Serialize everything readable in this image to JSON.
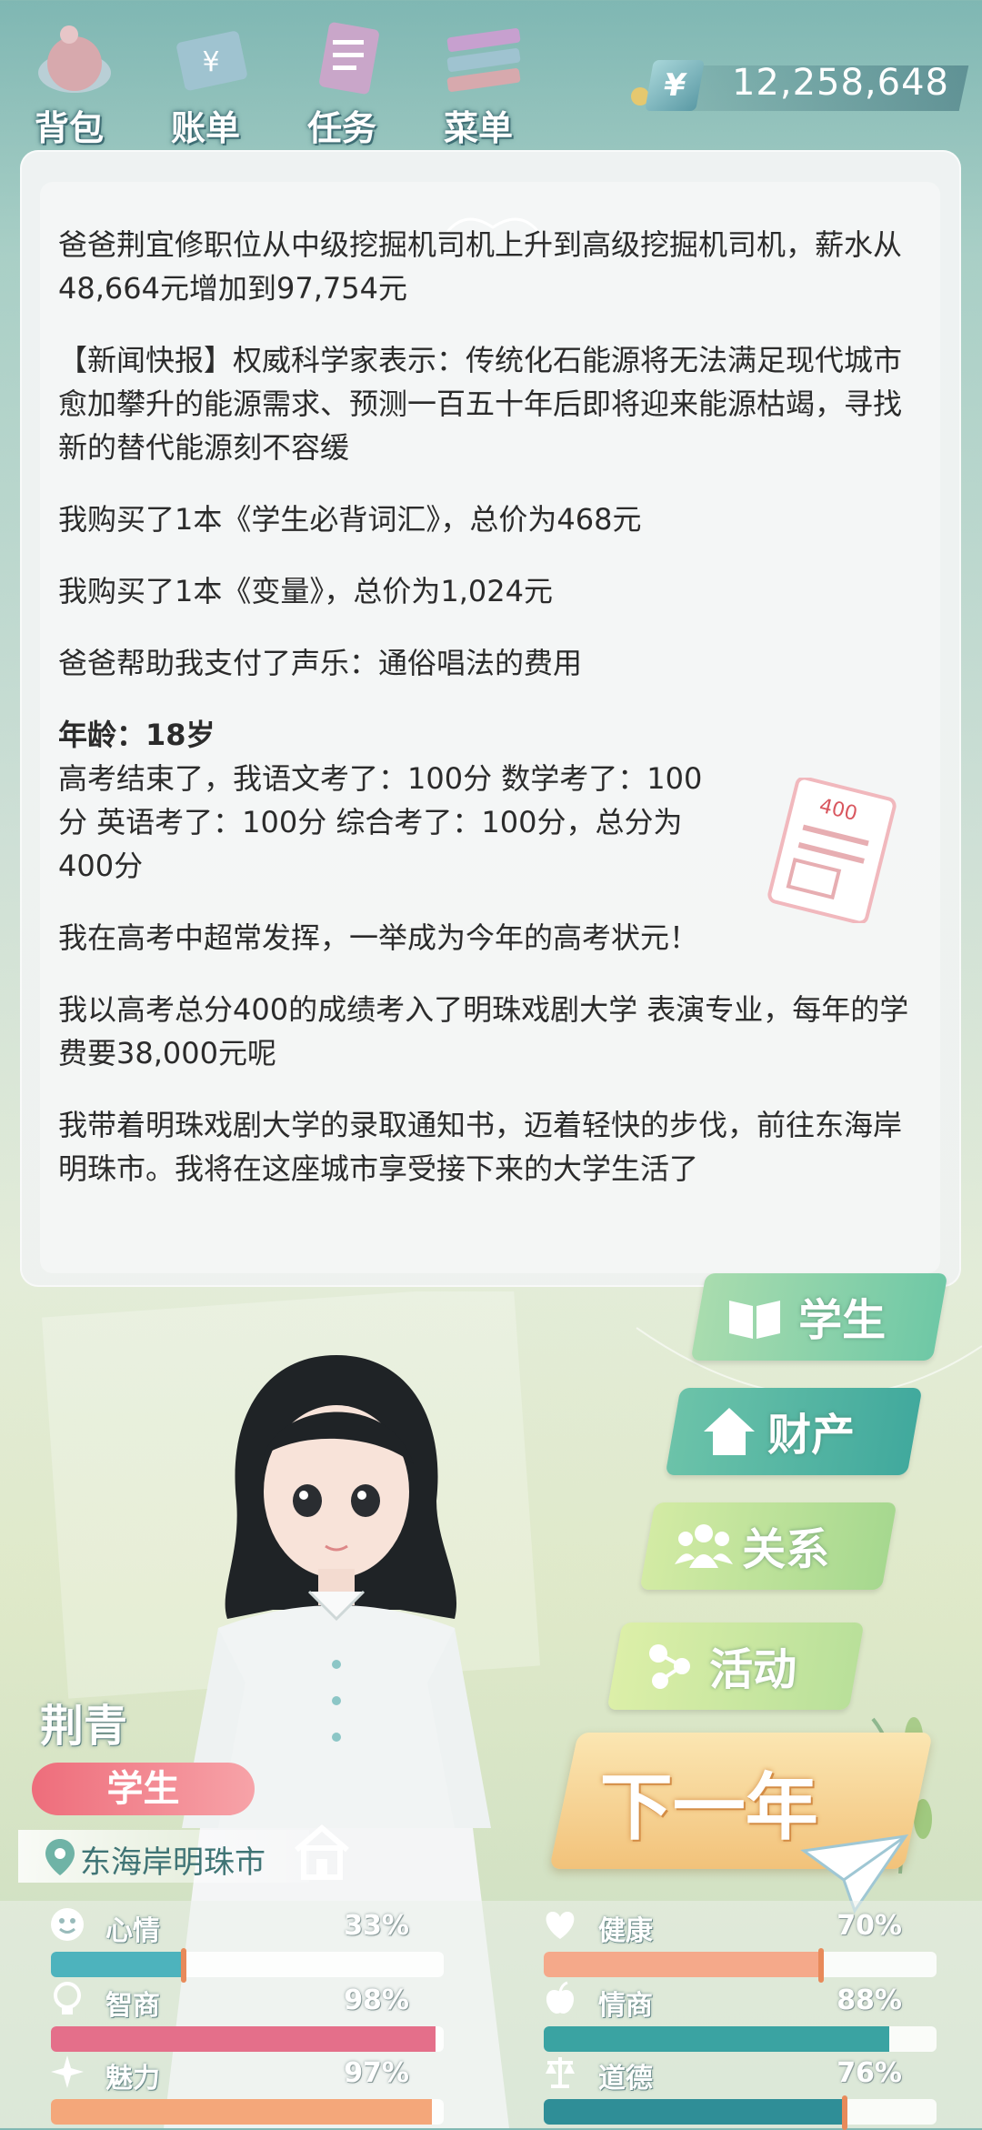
{
  "topbar": {
    "buttons": [
      {
        "label": "背包",
        "icon": "bag-icon"
      },
      {
        "label": "账单",
        "icon": "bill-icon"
      },
      {
        "label": "任务",
        "icon": "task-icon"
      },
      {
        "label": "菜单",
        "icon": "menu-icon"
      }
    ],
    "money": {
      "symbol": "¥",
      "value": "12,258,648"
    }
  },
  "log": {
    "entries": [
      "爸爸荆宜修职位从中级挖掘机司机上升到高级挖掘机司机，薪水从48,664元增加到97,754元",
      "【新闻快报】权威科学家表示：传统化石能源将无法满足现代城市愈加攀升的能源需求、预测一百五十年后即将迎来能源枯竭，寻找新的替代能源刻不容缓",
      "我购买了1本《学生必背词汇》，总价为468元",
      "我购买了1本《变量》，总价为1,024元",
      "爸爸帮助我支付了声乐：通俗唱法的费用"
    ],
    "age_line": "年龄：18岁",
    "exam_text": "高考结束了，我语文考了：100分  数学考了：100分  英语考了：100分  综合考了：100分，总分为400分",
    "paper_score": "400",
    "entries_after": [
      "我在高考中超常发挥，一举成为今年的高考状元！",
      "我以高考总分400的成绩考入了明珠戏剧大学  表演专业，每年的学费要38,000元呢",
      "我带着明珠戏剧大学的录取通知书，迈着轻快的步伐，前往东海岸明珠市。我将在这座城市享受接下来的大学生活了"
    ]
  },
  "character": {
    "name": "荆青",
    "role": "学生",
    "location": "东海岸明珠市"
  },
  "side_buttons": [
    {
      "label": "学生",
      "icon": "book-icon",
      "color": "#8fd0a6"
    },
    {
      "label": "财产",
      "icon": "house-icon",
      "color": "#5fbfa6"
    },
    {
      "label": "关系",
      "icon": "people-icon",
      "color": "#bfe09a"
    },
    {
      "label": "活动",
      "icon": "molecule-icon",
      "color": "#c7e39a"
    }
  ],
  "next_year_label": "下一年",
  "stats": [
    {
      "label": "心情",
      "value": "33%",
      "level": 0.33,
      "icon": "smile-icon",
      "color": "#4db3bd"
    },
    {
      "label": "健康",
      "value": "70%",
      "level": 0.7,
      "icon": "heart-icon",
      "color": "#f5a98a"
    },
    {
      "label": "智商",
      "value": "98%",
      "level": 0.98,
      "icon": "bulb-icon",
      "color": "#e46f8a"
    },
    {
      "label": "情商",
      "value": "88%",
      "level": 0.88,
      "icon": "apple-icon",
      "color": "#3aa3a2"
    },
    {
      "label": "魅力",
      "value": "97%",
      "level": 0.97,
      "icon": "sparkle-icon",
      "color": "#f4a77a"
    },
    {
      "label": "道德",
      "value": "76%",
      "level": 0.76,
      "icon": "scale-icon",
      "color": "#2f8e97"
    }
  ]
}
